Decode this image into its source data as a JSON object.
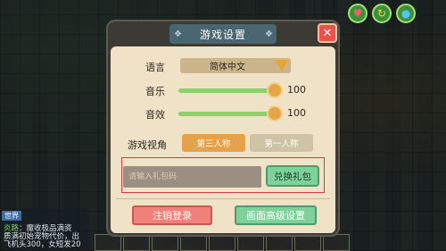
{
  "dialog": {
    "title": "游戏设置",
    "close_label": "✕"
  },
  "settings": {
    "language_label": "语言",
    "language_value": "简体中文",
    "music_label": "音乐",
    "music_value": "100",
    "sfx_label": "音效",
    "sfx_value": "100",
    "view_label": "游戏视角",
    "view_third": "第三人称",
    "view_first": "第一人称",
    "view_selected": "第三人称"
  },
  "gift": {
    "placeholder": "请输入礼包码",
    "redeem_label": "兑换礼包"
  },
  "footer": {
    "logout_label": "注销登录",
    "advanced_label": "画面高级设置"
  },
  "chat": {
    "channel": "世界",
    "line1_name": "炎路",
    "line1_text": "：魔收极品满资",
    "line2": "质满初始宠物代价，出",
    "line3": "飞机头300，女短发20"
  },
  "hud": {
    "icons": [
      "heart-icon",
      "refresh-icon",
      "drop-icon"
    ]
  },
  "colors": {
    "accent_orange": "#e6a24a",
    "accent_green": "#7fd19a",
    "accent_red": "#f0807a",
    "highlight_frame": "#d93a3a"
  }
}
